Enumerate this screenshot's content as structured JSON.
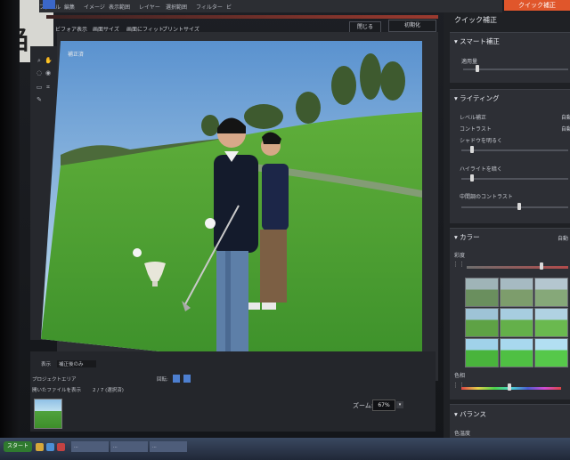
{
  "menubar": {
    "items": [
      "ファイル",
      "編集",
      "イメージ",
      "表示範囲",
      "レイヤー",
      "選択範囲",
      "フィルター",
      "ビ"
    ],
    "active_tab": "クイック補正"
  },
  "toolbar": {
    "items": [
      "ビフォア表示",
      "画面サイズ",
      "画面にフィット",
      "プリントサイズ"
    ],
    "close_label": "閉じる",
    "reset_label": "初期化"
  },
  "photo": {
    "label": "補正済"
  },
  "bottom": {
    "row1": [
      "表示",
      "補正後のみ"
    ],
    "row2": [
      "プロジェクトエリア"
    ],
    "row3": [
      "開いたファイルを表示",
      "2 / 7 (選択済)"
    ],
    "rotate_label": "回転:",
    "zoom_label": "ズーム:",
    "zoom_value": "67%"
  },
  "right_panel": {
    "title": "クイック補正",
    "smart_fix": {
      "title": "スマート補正",
      "amount_label": "適用量"
    },
    "lighting": {
      "title": "ライティング",
      "items": [
        "レベル補正",
        "コントラスト",
        "シャドウを明るく",
        "ハイライトを暗く",
        "中間調のコントラスト"
      ],
      "auto": "自動"
    },
    "color": {
      "title": "カラー",
      "auto": "自動",
      "saturation": "彩度",
      "hue": "色相"
    },
    "balance": {
      "title": "バランス",
      "temperature": "色温度"
    }
  },
  "taskbar": {
    "start": "スタート",
    "tasks": [
      "...",
      "...",
      "..."
    ]
  },
  "colors": {
    "accent": "#e0562b",
    "panel": "#2d2f35",
    "grass": "#4fa23c",
    "sky": "#8fc0e6"
  }
}
